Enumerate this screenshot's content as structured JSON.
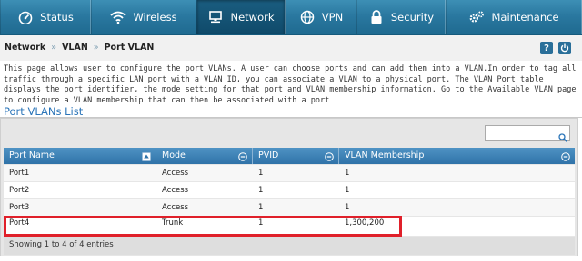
{
  "nav": {
    "tabs": [
      {
        "label": "Status",
        "icon": "speedometer-icon"
      },
      {
        "label": "Wireless",
        "icon": "wifi-icon"
      },
      {
        "label": "Network",
        "icon": "monitor-icon",
        "active": true
      },
      {
        "label": "VPN",
        "icon": "globe-icon"
      },
      {
        "label": "Security",
        "icon": "lock-icon"
      },
      {
        "label": "Maintenance",
        "icon": "gears-icon"
      }
    ],
    "colors": {
      "bar": "#2a78a0",
      "active": "#0f4a6a"
    }
  },
  "breadcrumb": [
    "Network",
    "VLAN",
    "Port VLAN"
  ],
  "breadcrumb_sep": "»",
  "help": {
    "help_label": "?",
    "logout_icon": "power-icon"
  },
  "description": "This page allows user to configure the port VLANs. A user can choose ports and can add them into a VLAN.In order to tag all traffic through a specific LAN port with a VLAN ID, you can associate a VLAN to a physical port. The VLAN Port table displays the port identifier, the mode setting for that port and VLAN membership information. Go to the Available VLAN page to configure a VLAN membership that can then be associated with a port",
  "list_title": "Port VLANs List",
  "search": {
    "value": "",
    "placeholder": ""
  },
  "table": {
    "columns": [
      "Port Name",
      "Mode",
      "PVID",
      "VLAN Membership"
    ],
    "rows": [
      [
        "Port1",
        "Access",
        "1",
        "1"
      ],
      [
        "Port2",
        "Access",
        "1",
        "1"
      ],
      [
        "Port3",
        "Access",
        "1",
        "1"
      ],
      [
        "Port4",
        "Trunk",
        "1",
        "1,300,200"
      ]
    ],
    "highlighted_row": 3
  },
  "footer": "Showing 1 to 4 of 4 entries",
  "accent": "#2a74b8",
  "highlight_color": "#e0202a"
}
